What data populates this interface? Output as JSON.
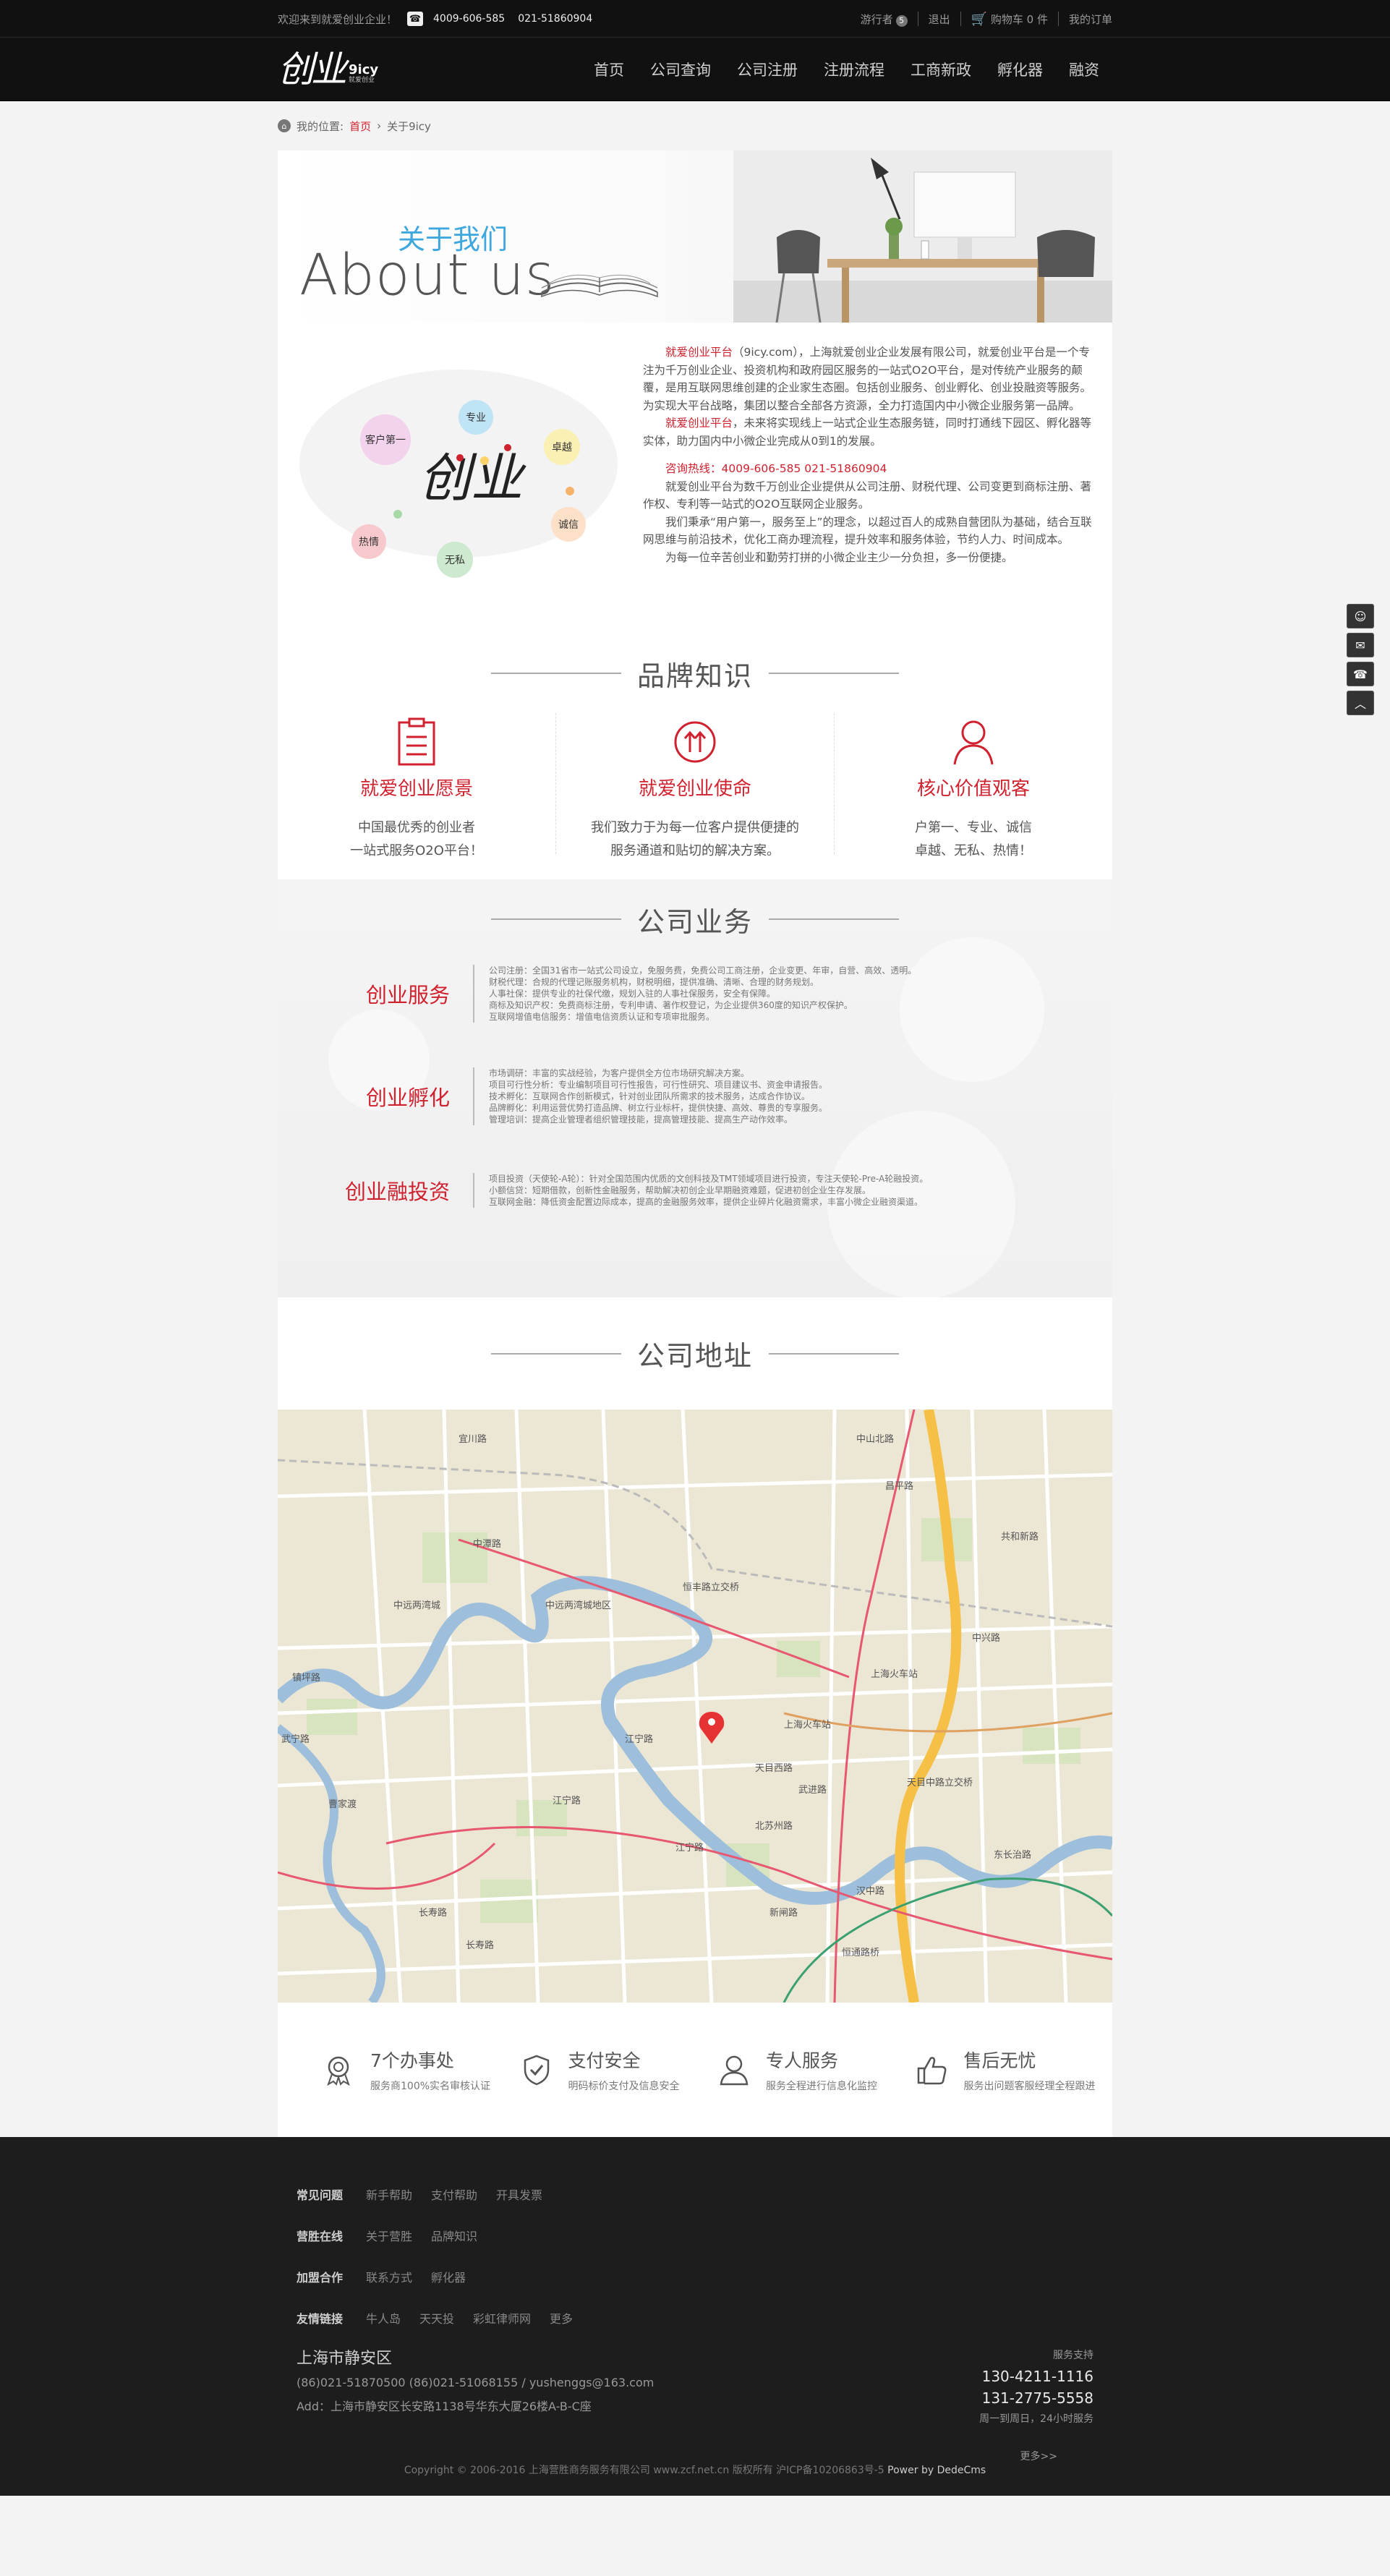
{
  "topbar": {
    "welcome": "欢迎来到就爱创业企业！",
    "phone1": "4009-606-585",
    "phone2": "021-51860904",
    "visitor": "游行者",
    "visitor_count": "5",
    "logout": "退出",
    "cart": "购物车 0 件",
    "orders": "我的订单"
  },
  "logo": {
    "mark": "创业",
    "name": "9icy",
    "tag": "就爱创业"
  },
  "nav": [
    "首页",
    "公司查询",
    "公司注册",
    "注册流程",
    "工商新政",
    "孵化器",
    "融资"
  ],
  "breadcrumb": {
    "label": "我的位置:",
    "home": "首页",
    "sep": "›",
    "current": "关于9icy"
  },
  "banner": {
    "zh": "关于我们",
    "en": "About us"
  },
  "about": {
    "bubbles": [
      "客户第一",
      "专业",
      "卓越",
      "诚信",
      "无私",
      "热情"
    ],
    "p1_red": "就爱创业平台",
    "p1": "（9icy.com），上海就爱创业企业发展有限公司，就爱创业平台是一个专注为千万创业企业、投资机构和政府园区服务的一站式O2O平台，是对传统产业服务的颠覆，是用互联网思维创建的企业家生态圈。包括创业服务、创业孵化、创业投融资等服务。为实现大平台战略，集团以整合全部各方资源，全力打造国内中小微企业服务第一品牌。",
    "p2_red": "就爱创业平台",
    "p2": "，未来将实现线上一站式企业生态服务链，同时打通线下园区、孵化器等实体，助力国内中小微企业完成从0到1的发展。",
    "hotline": "咨询热线：4009-606-585    021-51860904",
    "p3": "就爱创业平台为数千万创业企业提供从公司注册、财税代理、公司变更到商标注册、著作权、专利等一站式的O2O互联网企业服务。",
    "p4": "我们秉承“用户第一，服务至上”的理念，以超过百人的成熟自营团队为基础，结合互联网思维与前沿技术，优化工商办理流程，提升效率和服务体验，节约人力、时间成本。",
    "p5": "为每一位辛苦创业和勤劳打拼的小微企业主少一分负担，多一份便捷。"
  },
  "brand": {
    "title": "品牌知识",
    "items": [
      {
        "title": "就爱创业愿景",
        "line1": "中国最优秀的创业者",
        "line2": "一站式服务O2O平台！"
      },
      {
        "title": "就爱创业使命",
        "line1": "我们致力于为每一位客户提供便捷的",
        "line2": "服务通道和贴切的解决方案。"
      },
      {
        "title": "核心价值观客",
        "line1": "户第一、专业、诚信",
        "line2": "卓越、无私、热情！"
      }
    ]
  },
  "business": {
    "title": "公司业务",
    "items": [
      {
        "name": "创业服务",
        "lines": [
          "公司注册：全国31省市一站式公司设立，免服务费，免费公司工商注册，企业变更、年审，自营、高效、透明。",
          "财税代理：合规的代理记账服务机构，财税明细，提供准确、清晰、合理的财务规划。",
          "人事社保：提供专业的社保代缴，规划入驻的人事社保服务，安全有保障。",
          "商标及知识产权：免费商标注册，专利申请、著作权登记，为企业提供360度的知识产权保护。",
          "互联网增值电信服务：增值电信资质认证和专项审批服务。"
        ]
      },
      {
        "name": "创业孵化",
        "lines": [
          "市场调研：丰富的实战经验，为客户提供全方位市场研究解决方案。",
          "项目可行性分析：专业编制项目可行性报告，可行性研究、项目建议书、资金申请报告。",
          "技术孵化：互联网合作创新模式，针对创业团队所需求的技术服务，达成合作协议。",
          "品牌孵化：利用运营优势打造品牌、树立行业标杆，提供快捷、高效、尊贵的专享服务。",
          "管理培训：提高企业管理者组织管理技能，提高管理技能、提高生产动作效率。"
        ]
      },
      {
        "name": "创业融投资",
        "lines": [
          "项目投资（天使轮-A轮）：针对全国范围内优质的文创科技及TMT领域项目进行投资，专注天使轮-Pre-A轮融投资。",
          "小额信贷：短期借款，创新性金融服务，帮助解决初创企业早期融资难题，促进初创企业生存发展。",
          "互联网金融：降低资金配置边际成本，提高的金融服务效率，提供企业碎片化融资需求，丰富小微企业融资渠道。"
        ]
      }
    ]
  },
  "address": {
    "title": "公司地址",
    "map_labels": [
      "宜川路",
      "中山北路",
      "上海火车站",
      "中潭路",
      "江宁路",
      "昌平路",
      "天目西路",
      "恒丰路立交桥",
      "长寿路",
      "中远两湾城",
      "曹家渡",
      "武宁路",
      "汉中路",
      "北苏州路",
      "江宁路",
      "上海火车站",
      "东长治路",
      "天目中路立交桥",
      "长寿路",
      "江宁路",
      "共和新路",
      "中兴路",
      "武进路",
      "恒通路桥",
      "新闸路",
      "镇坪路",
      "中远两湾城地区"
    ]
  },
  "features": [
    {
      "title": "7个办事处",
      "sub": "服务商100%实名审核认证"
    },
    {
      "title": "支付安全",
      "sub": "明码标价支付及信息安全"
    },
    {
      "title": "专人服务",
      "sub": "服务全程进行信息化监控"
    },
    {
      "title": "售后无忧",
      "sub": "服务出问题客服经理全程跟进"
    }
  ],
  "footer": {
    "rows": [
      {
        "label": "常见问题",
        "links": [
          "新手帮助",
          "支付帮助",
          "开具发票"
        ]
      },
      {
        "label": "营胜在线",
        "links": [
          "关于营胜",
          "品牌知识"
        ]
      },
      {
        "label": "加盟合作",
        "links": [
          "联系方式",
          "孵化器"
        ]
      },
      {
        "label": "友情链接",
        "links": [
          "牛人岛",
          "天天投",
          "彩虹律师网",
          "更多"
        ]
      }
    ],
    "city": "上海市静安区",
    "phones": "(86)021-51870500      (86)021-51068155 / yushenggs@163.com",
    "addr": "Add：上海市静安区长安路1138号华东大厦26楼A-B-C座",
    "support_label": "服务支持",
    "support1": "130-4211-1116",
    "support2": "131-2775-5558",
    "support_time": "周一到周日，24小时服务",
    "more": "更多>>",
    "copyright": "Copyright © 2006-2016 上海营胜商务服务有限公司 www.zcf.net.cn 版权所有 沪ICP备10206863号-5 ",
    "power": "Power by DedeCms"
  },
  "colors": {
    "accent": "#d0212e",
    "blue": "#3ea7dd",
    "dark": "#111111"
  }
}
